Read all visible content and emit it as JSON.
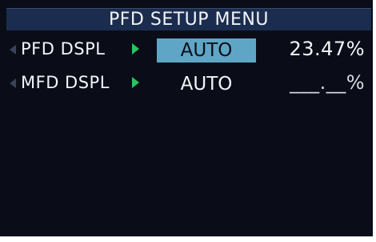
{
  "header": {
    "title": "PFD SETUP MENU"
  },
  "rows": [
    {
      "label": "PFD DSPL",
      "value": "AUTO",
      "percent": "23.47%",
      "selected": true
    },
    {
      "label": "MFD DSPL",
      "value": "AUTO",
      "percent": "___.__%",
      "selected": false
    }
  ],
  "colors": {
    "background": "#0a0d18",
    "title_bar": "#1b2d4e",
    "selection_cyan": "#5fa6c6",
    "arrow_green": "#2cc35c",
    "text_white": "#f2f4f8"
  },
  "icons": {
    "row_arrow": "green-right-triangle-icon",
    "knob_arrow": "left-triangle-icon"
  }
}
